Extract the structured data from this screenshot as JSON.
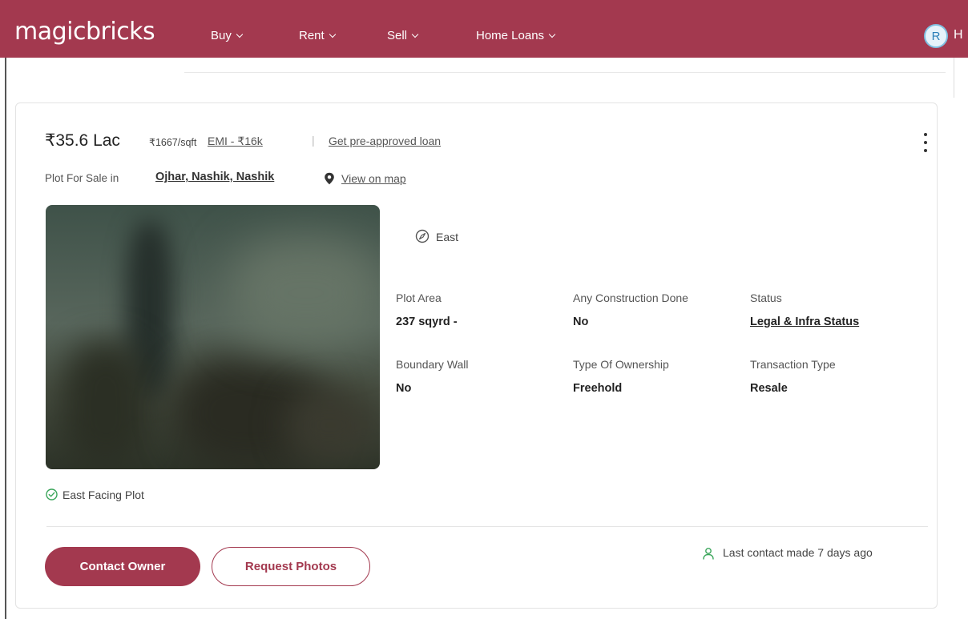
{
  "header": {
    "logo": "magicbricks",
    "nav": [
      {
        "label": "Buy"
      },
      {
        "label": "Rent"
      },
      {
        "label": "Sell"
      },
      {
        "label": "Home Loans"
      }
    ],
    "avatar_letter": "R",
    "truncated_text": "H"
  },
  "listing": {
    "price": "₹35.6 Lac",
    "price_per_sqft": "₹1667/sqft",
    "emi_link": "EMI - ₹16k",
    "separator": "|",
    "loan_link": "Get pre-approved loan",
    "subtitle_prefix": "Plot For Sale in",
    "locality": "Ojhar, Nashik, Nashik",
    "map_link": "View on map",
    "facing": "East",
    "attributes": [
      {
        "label": "Plot Area",
        "value": "237 sqyrd -"
      },
      {
        "label": "Any Construction Done",
        "value": "No"
      },
      {
        "label": "Status",
        "value": "Legal & Infra Status"
      },
      {
        "label": "Boundary Wall",
        "value": "No"
      },
      {
        "label": "Type Of Ownership",
        "value": "Freehold"
      },
      {
        "label": "Transaction Type",
        "value": "Resale"
      }
    ],
    "tag": "East Facing Plot",
    "actions": {
      "contact_owner": "Contact Owner",
      "request_photos": "Request Photos"
    },
    "last_contact": "Last contact made 7 days ago"
  },
  "colors": {
    "brand": "#a3394f",
    "success": "#3aa55a"
  }
}
